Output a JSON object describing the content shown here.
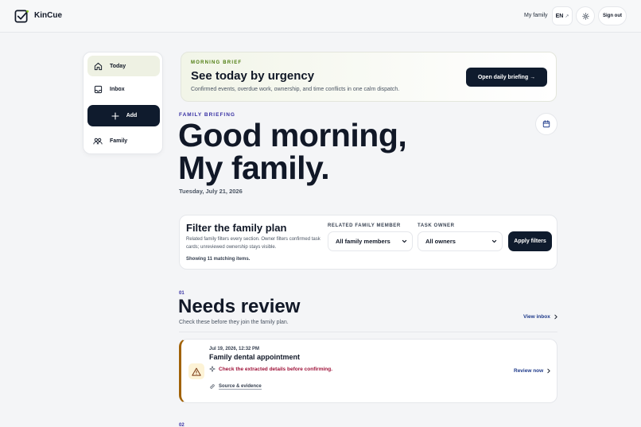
{
  "header": {
    "app_name": "KinCue",
    "family_link": "My family",
    "lang_label": "EN",
    "lang_ext": "↗",
    "signout_label": "Sign out"
  },
  "sidebar": {
    "items": [
      {
        "label": "Today",
        "icon": "home-icon"
      },
      {
        "label": "Inbox",
        "icon": "inbox-icon"
      },
      {
        "label": "Add",
        "icon": "plus-icon"
      },
      {
        "label": "Family",
        "icon": "people-icon"
      }
    ]
  },
  "brief": {
    "eyebrow": "MORNING BRIEF",
    "title": "See today by urgency",
    "subtitle": "Confirmed events, overdue work, ownership, and time conflicts in one calm dispatch.",
    "cta": "Open daily briefing →"
  },
  "greeting": {
    "kicker": "FAMILY BRIEFING",
    "line1": "Good morning,",
    "line2": "My family.",
    "date": "Tuesday, July 21, 2026"
  },
  "filter": {
    "title": "Filter the family plan",
    "description": "Related family filters every section. Owner filters confirmed task cards; unreviewed ownership stays visible.",
    "count": "Showing 11 matching items.",
    "member_label": "RELATED FAMILY MEMBER",
    "member_value": "All family members",
    "owner_label": "TASK OWNER",
    "owner_value": "All owners",
    "apply": "Apply filters"
  },
  "section": {
    "number": "01",
    "title": "Needs review",
    "subtitle": "Check these before they join the family plan.",
    "view_link": "View inbox"
  },
  "review_card": {
    "timestamp": "Jul 19, 2026, 12:32 PM",
    "title": "Family dental appointment",
    "warning": "Check the extracted details before confirming.",
    "source": "Source & evidence",
    "action": "Review now"
  },
  "next_section": {
    "number": "02"
  },
  "colors": {
    "navy": "#0f1b2d",
    "accent_green": "#4d7c0f",
    "indigo": "#3730a3",
    "warning_red": "#9f1239",
    "amber_border": "#a16207"
  }
}
